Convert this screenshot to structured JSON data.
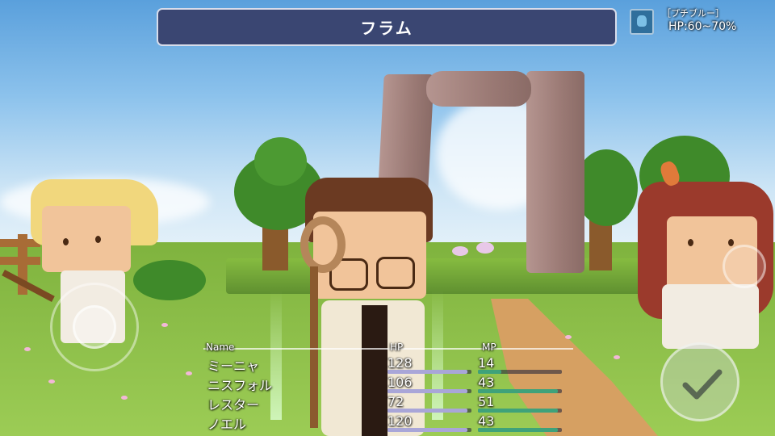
{
  "battle": {
    "skill_name": "フラム"
  },
  "enemy": {
    "name": "［プチブルー］",
    "hp": "HP:60~70%"
  },
  "party": {
    "headers": {
      "name": "Name",
      "hp": "HP",
      "mp": "MP"
    },
    "members": [
      {
        "name": "ミーニャ",
        "hp": "128",
        "mp": "14",
        "hp_fill": 0.95,
        "mp_fill": 0.28
      },
      {
        "name": "ニスフォル",
        "hp": "106",
        "mp": "43",
        "hp_fill": 0.95,
        "mp_fill": 0.95
      },
      {
        "name": "レスター",
        "hp": "72",
        "mp": "51",
        "hp_fill": 0.95,
        "mp_fill": 0.95
      },
      {
        "name": "ノエル",
        "hp": "120",
        "mp": "43",
        "hp_fill": 0.95,
        "mp_fill": 0.95
      }
    ]
  },
  "colors": {
    "title_bar": "#3a4672",
    "hp_bar": "#a9a6d8",
    "mp_bar": "#3fa27a"
  },
  "icons": {
    "enemy": "blue-slime-icon",
    "confirm": "checkmark-icon",
    "joystick": "virtual-joystick"
  }
}
